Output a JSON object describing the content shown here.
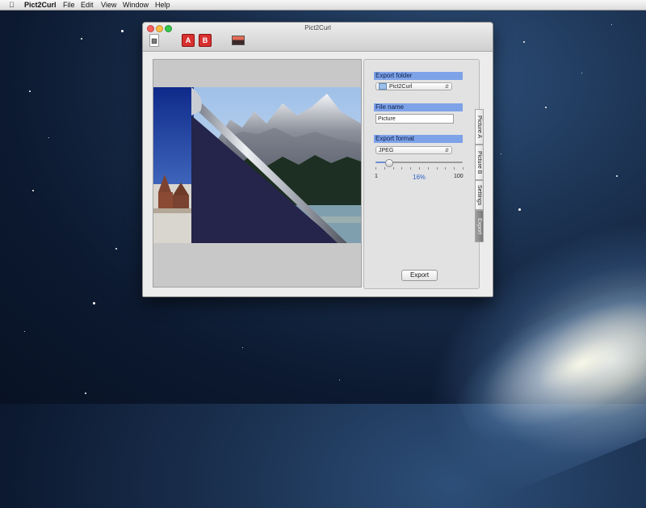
{
  "menubar": {
    "app_name": "Pict2Curl",
    "items": [
      "File",
      "Edit",
      "View",
      "Window",
      "Help"
    ]
  },
  "window": {
    "title": "Pict2Curl",
    "toolbar": {
      "picture_a_label": "A",
      "picture_b_label": "B"
    }
  },
  "panel": {
    "export_folder_label": "Export folder",
    "export_folder_value": "Pict2Curl",
    "file_name_label": "File name",
    "file_name_value": "Picture",
    "export_format_label": "Export format",
    "export_format_value": "JPEG",
    "quality": {
      "min": "1",
      "max": "100",
      "value_text": "16%",
      "value": 16
    },
    "export_button": "Export"
  },
  "tabs": [
    "Picture A",
    "Picture B",
    "Settings",
    "Export"
  ],
  "selected_tab": "Export",
  "colors": {
    "section_header": "#7ea2e8",
    "slider_value": "#2f63c7",
    "curl_back": "#25244a"
  }
}
